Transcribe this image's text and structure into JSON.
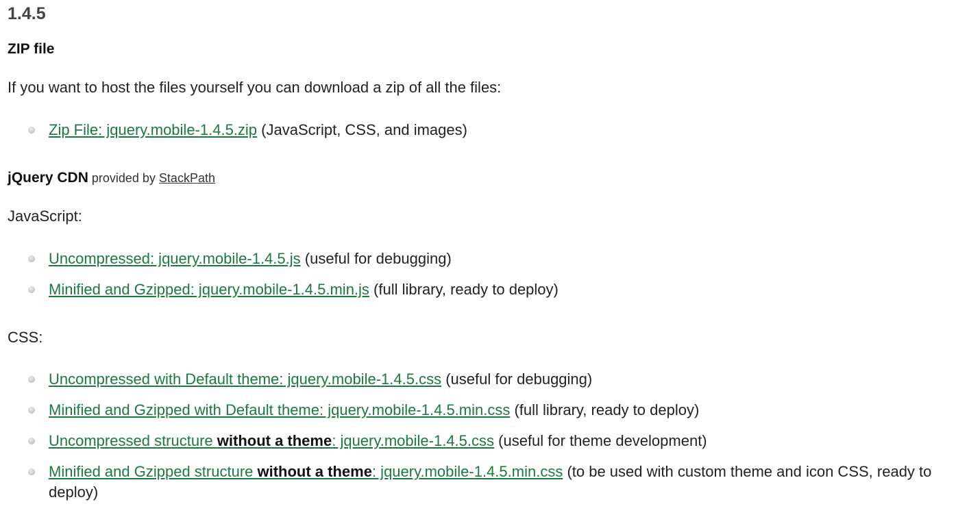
{
  "version_heading": "1.4.5",
  "zip": {
    "heading": "ZIP file",
    "intro": "If you want to host the files yourself you can download a zip of all the files:",
    "items": [
      {
        "link": "Zip File: jquery.mobile-1.4.5.zip",
        "note": " (JavaScript, CSS, and images)"
      }
    ]
  },
  "cdn": {
    "heading": "jQuery CDN",
    "provided_by": " provided by ",
    "provider_link": "StackPath",
    "js_label": "JavaScript:",
    "js_items": [
      {
        "link": "Uncompressed: jquery.mobile-1.4.5.js",
        "note": " (useful for debugging)"
      },
      {
        "link": "Minified and Gzipped: jquery.mobile-1.4.5.min.js",
        "note": " (full library, ready to deploy)"
      }
    ],
    "css_label": "CSS:",
    "css_items": [
      {
        "link": "Uncompressed with Default theme: jquery.mobile-1.4.5.css",
        "note": " (useful for debugging)"
      },
      {
        "link": "Minified and Gzipped with Default theme: jquery.mobile-1.4.5.min.css",
        "note": " (full library, ready to deploy)"
      },
      {
        "link_pre": "Uncompressed structure ",
        "link_bold": "without a theme",
        "link_post": ": jquery.mobile-1.4.5.css",
        "note": " (useful for theme development)"
      },
      {
        "link_pre": "Minified and Gzipped structure ",
        "link_bold": "without a theme",
        "link_post": ": jquery.mobile-1.4.5.min.css",
        "note": " (to be used with custom theme and icon CSS, ready to deploy)"
      }
    ]
  },
  "colors": {
    "link": "#1a7a3c",
    "text": "#222222",
    "heading": "#444444"
  }
}
